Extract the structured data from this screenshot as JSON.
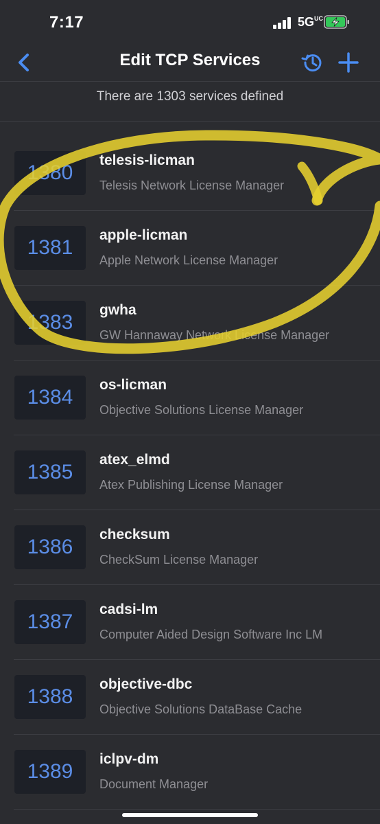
{
  "status_bar": {
    "time": "7:17",
    "network": "5G",
    "network_suffix": "UC"
  },
  "nav": {
    "title": "Edit TCP Services",
    "back_icon": "chevron-left-icon",
    "history_icon": "history-icon",
    "add_icon": "plus-icon"
  },
  "summary": "There are 1303 services defined",
  "colors": {
    "accent": "#4b8df2",
    "port_text": "#5b8de6",
    "background": "#2b2c30",
    "badge": "#1d2027",
    "highlight": "#e6cf2f"
  },
  "services": [
    {
      "port": "1380",
      "name": "telesis-licman",
      "description": "Telesis Network License Manager"
    },
    {
      "port": "1381",
      "name": "apple-licman",
      "description": "Apple Network License Manager"
    },
    {
      "port": "1383",
      "name": "gwha",
      "description": "GW Hannaway Network License Manager"
    },
    {
      "port": "1384",
      "name": "os-licman",
      "description": "Objective Solutions License Manager"
    },
    {
      "port": "1385",
      "name": "atex_elmd",
      "description": "Atex Publishing License Manager"
    },
    {
      "port": "1386",
      "name": "checksum",
      "description": "CheckSum License Manager"
    },
    {
      "port": "1387",
      "name": "cadsi-lm",
      "description": "Computer Aided Design Software Inc LM"
    },
    {
      "port": "1388",
      "name": "objective-dbc",
      "description": "Objective Solutions DataBase Cache"
    },
    {
      "port": "1389",
      "name": "iclpv-dm",
      "description": "Document Manager"
    }
  ]
}
